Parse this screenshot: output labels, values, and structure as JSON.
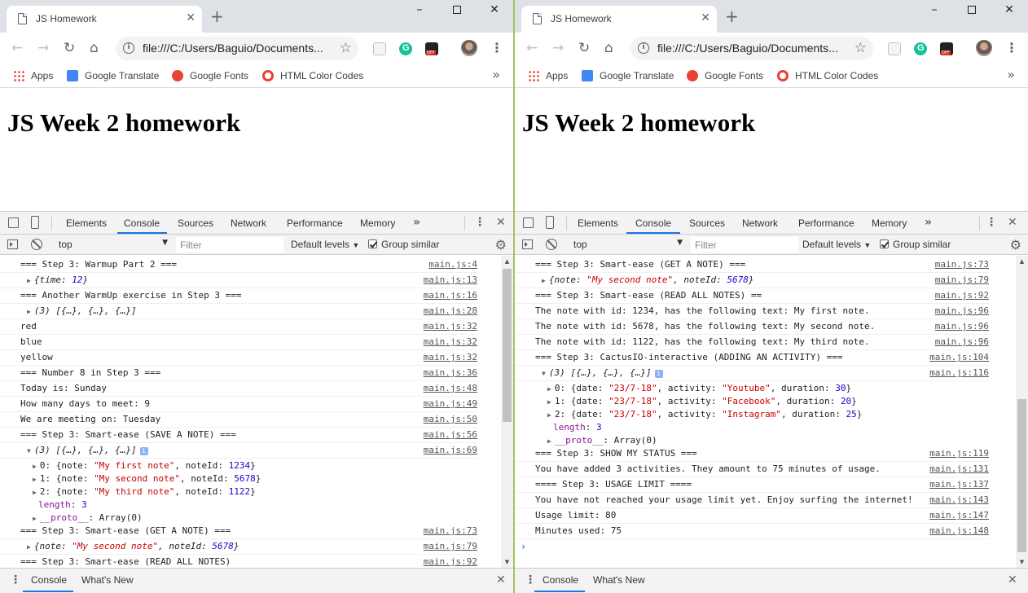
{
  "browser": {
    "tab_title": "JS Homework",
    "tab_close": "✕",
    "new_tab": "+",
    "url": "file:///C:/Users/Baguio/Documents...",
    "window_min": "–",
    "window_close": "✕",
    "bookmarks": [
      "Apps",
      "Google Translate",
      "Google Fonts",
      "HTML Color Codes"
    ],
    "bookmarks_more": "»"
  },
  "page": {
    "heading": "JS Week 2 homework"
  },
  "devtools": {
    "tabs": [
      "Elements",
      "Console",
      "Sources",
      "Network",
      "Performance",
      "Memory"
    ],
    "more_tabs": "»",
    "active_tab": "Console",
    "context": "top",
    "filter_placeholder": "Filter",
    "levels": "Default levels",
    "group_similar": "Group similar",
    "drawer_tabs": [
      "Console",
      "What's New"
    ]
  },
  "left_console": [
    {
      "text": "=== Step 3: Warmup Part 2 ===",
      "src": "main.js:4"
    },
    {
      "text": "{time: 12}",
      "src": "main.js:13"
    },
    {
      "text": "=== Another WarmUp exercise in Step 3 ===",
      "src": "main.js:16"
    },
    {
      "text": "(3) [{…}, {…}, {…}]",
      "src": "main.js:28"
    },
    {
      "text": "red",
      "src": "main.js:32"
    },
    {
      "text": "blue",
      "src": "main.js:32"
    },
    {
      "text": "yellow",
      "src": "main.js:32"
    },
    {
      "text": "=== Number 8 in Step 3 ===",
      "src": "main.js:36"
    },
    {
      "text": "Today is: Sunday",
      "src": "main.js:48"
    },
    {
      "text": "How many days to meet: 9",
      "src": "main.js:49"
    },
    {
      "text": "We are meeting on: Tuesday",
      "src": "main.js:50"
    },
    {
      "text": "=== Step 3: Smart-ease (SAVE A NOTE) ===",
      "src": "main.js:56"
    },
    {
      "text": "(3) [{…}, {…}, {…}]",
      "src": "main.js:69"
    },
    {
      "text": "0: {note: \"My first note\", noteId: 1234}"
    },
    {
      "text": "1: {note: \"My second note\", noteId: 5678}"
    },
    {
      "text": "2: {note: \"My third note\", noteId: 1122}"
    },
    {
      "text": "length: 3"
    },
    {
      "text": "__proto__: Array(0)"
    },
    {
      "text": "=== Step 3: Smart-ease (GET A NOTE) ===",
      "src": "main.js:73"
    },
    {
      "text": "{note: \"My second note\", noteId: 5678}",
      "src": "main.js:79"
    },
    {
      "text": "=== Step 3: Smart-ease (READ ALL NOTES)",
      "src": "main.js:92"
    }
  ],
  "right_console": [
    {
      "text": "=== Step 3: Smart-ease (GET A NOTE) ===",
      "src": "main.js:73"
    },
    {
      "text": "{note: \"My second note\", noteId: 5678}",
      "src": "main.js:79"
    },
    {
      "text": "=== Step 3: Smart-ease (READ ALL NOTES) ==",
      "src": "main.js:92"
    },
    {
      "text": "The note with id: 1234, has the following text: My first note.",
      "src": "main.js:96"
    },
    {
      "text": "The note with id: 5678, has the following text: My second note.",
      "src": "main.js:96"
    },
    {
      "text": "The note with id: 1122, has the following text: My third note.",
      "src": "main.js:96"
    },
    {
      "text": "=== Step 3: CactusIO-interactive (ADDING AN ACTIVITY) ===",
      "src": "main.js:104"
    },
    {
      "text": "(3) [{…}, {…}, {…}]",
      "src": "main.js:116"
    },
    {
      "text": "0: {date: \"23/7-18\", activity: \"Youtube\", duration: 30}"
    },
    {
      "text": "1: {date: \"23/7-18\", activity: \"Facebook\", duration: 20}"
    },
    {
      "text": "2: {date: \"23/7-18\", activity: \"Instagram\", duration: 25}"
    },
    {
      "text": "length: 3"
    },
    {
      "text": "__proto__: Array(0)"
    },
    {
      "text": "=== Step 3: SHOW MY STATUS ===",
      "src": "main.js:119"
    },
    {
      "text": "You have added 3 activities. They amount to 75 minutes of usage.",
      "src": "main.js:131"
    },
    {
      "text": "==== Step 3: USAGE LIMIT ====",
      "src": "main.js:137"
    },
    {
      "text": "You have not reached your usage limit yet. Enjoy surfing the internet!",
      "src": "main.js:143"
    },
    {
      "text": "Usage limit: 80",
      "src": "main.js:147"
    },
    {
      "text": "Minutes used: 75",
      "src": "main.js:148"
    }
  ],
  "colors": {
    "string": "#c80000",
    "number": "#1c00cf",
    "property": "#881391",
    "accent": "#1a73e8"
  }
}
